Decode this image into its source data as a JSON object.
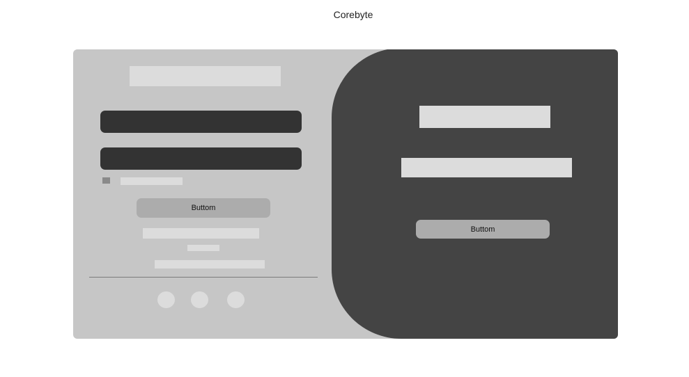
{
  "app": {
    "title": "Corebyte"
  },
  "signin_panel": {
    "submit_label": "Buttom"
  },
  "overlay_panel": {
    "action_label": "Buttom"
  },
  "colors": {
    "card": "#c6c6c6",
    "overlay": "#444444",
    "input": "#333333",
    "button": "#acacac",
    "placeholder": "#dcdcdc"
  }
}
